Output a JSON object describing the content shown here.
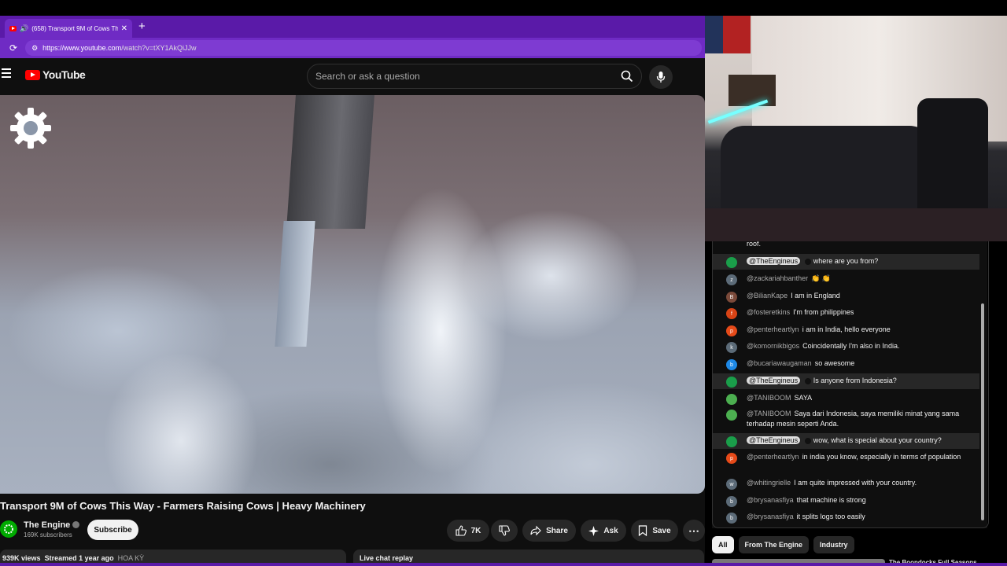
{
  "browser": {
    "tab_title": "(658) Transport 9M of Cows Th",
    "url_prefix": "https://",
    "url_host": "www.youtube.com",
    "url_path": "/watch?v=tXY1AkQiJJw"
  },
  "header": {
    "logo_text": "YouTube",
    "search_placeholder": "Search or ask a question"
  },
  "video": {
    "title": "Transport 9M of Cows This Way - Farmers Raising Cows | Heavy Machinery",
    "channel_name": "The Engine",
    "subscribers": "169K subscribers",
    "subscribe_label": "Subscribe",
    "likes": "7K",
    "share_label": "Share",
    "ask_label": "Ask",
    "save_label": "Save",
    "views": "939K views",
    "streamed": "Streamed 1 year ago",
    "location": "HOA KỲ",
    "live_chat_replay": "Live chat replay"
  },
  "chat": {
    "overflow_text": "roof.",
    "messages": [
      {
        "user": "@TheEngineus",
        "text": "where are you from?",
        "owner": true,
        "initial": "",
        "color": "#1a9e4a"
      },
      {
        "user": "@zackariahbanther",
        "text": "👏 👏",
        "owner": false,
        "initial": "z",
        "color": "#5c6b78"
      },
      {
        "user": "@BilianKape",
        "text": "I am in England",
        "owner": false,
        "initial": "B",
        "color": "#7b4a3a"
      },
      {
        "user": "@fosteretkins",
        "text": "I'm from philippines",
        "owner": false,
        "initial": "f",
        "color": "#d84315"
      },
      {
        "user": "@penterheartlyn",
        "text": "i am in India, hello everyone",
        "owner": false,
        "initial": "p",
        "color": "#e64a19"
      },
      {
        "user": "@komornikbigos",
        "text": "Coincidentally I'm also in India.",
        "owner": false,
        "initial": "k",
        "color": "#5c6b78"
      },
      {
        "user": "@bucariawaugaman",
        "text": "so awesome",
        "owner": false,
        "initial": "b",
        "color": "#1e88e5"
      },
      {
        "user": "@TheEngineus",
        "text": "Is anyone from Indonesia?",
        "owner": true,
        "initial": "",
        "color": "#1a9e4a"
      },
      {
        "user": "@TANIBOOM",
        "text": "SAYA",
        "owner": false,
        "initial": "",
        "color": "#4caf50"
      },
      {
        "user": "@TANIBOOM",
        "text": "Saya dari Indonesia, saya memiliki minat yang sama terhadap mesin seperti Anda.",
        "owner": false,
        "initial": "",
        "color": "#4caf50"
      },
      {
        "user": "@TheEngineus",
        "text": "wow, what is special about your country?",
        "owner": true,
        "initial": "",
        "color": "#1a9e4a"
      },
      {
        "user": "@penterheartlyn",
        "text": "in india you know, especially in terms of population",
        "owner": false,
        "initial": "p",
        "color": "#e64a19"
      },
      {
        "user": "@whitingrielle",
        "text": "I am quite impressed with your country.",
        "owner": false,
        "initial": "w",
        "color": "#5c6b78"
      },
      {
        "user": "@brysanasfiya",
        "text": "that machine is strong",
        "owner": false,
        "initial": "b",
        "color": "#5c6b78"
      },
      {
        "user": "@brysanasfiya",
        "text": "it splits logs too easily",
        "owner": false,
        "initial": "b",
        "color": "#5c6b78"
      }
    ]
  },
  "chips": {
    "all": "All",
    "from_engine": "From The Engine",
    "industry": "Industry"
  },
  "next_video_title": "The Boondocks Full Seasons"
}
